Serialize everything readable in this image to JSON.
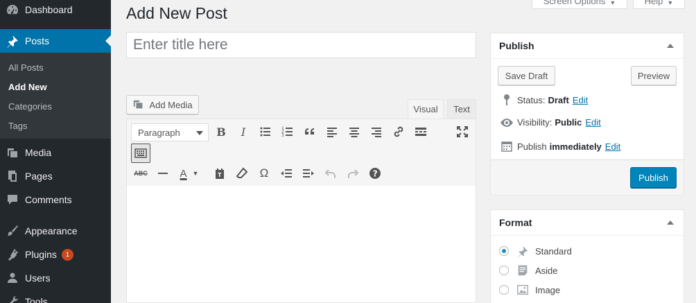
{
  "sidebar": {
    "items": [
      {
        "label": "Dashboard",
        "icon": "dashboard-icon"
      },
      {
        "label": "Posts",
        "icon": "pin-icon"
      },
      {
        "label": "Media",
        "icon": "media-icon"
      },
      {
        "label": "Pages",
        "icon": "pages-icon"
      },
      {
        "label": "Comments",
        "icon": "comment-icon"
      },
      {
        "label": "Appearance",
        "icon": "paintbrush-icon"
      },
      {
        "label": "Plugins",
        "icon": "plugin-icon",
        "badge": "1"
      },
      {
        "label": "Users",
        "icon": "user-icon"
      },
      {
        "label": "Tools",
        "icon": "wrench-icon"
      }
    ],
    "submenu": [
      "All Posts",
      "Add New",
      "Categories",
      "Tags"
    ]
  },
  "header": {
    "screen_options": "Screen Options",
    "help": "Help",
    "page_title": "Add New Post"
  },
  "editor": {
    "title_placeholder": "Enter title here",
    "add_media": "Add Media",
    "tab_visual": "Visual",
    "tab_text": "Text",
    "format_value": "Paragraph"
  },
  "publish_box": {
    "heading": "Publish",
    "save_draft": "Save Draft",
    "preview": "Preview",
    "status_label": "Status:",
    "status_value": "Draft",
    "visibility_label": "Visibility:",
    "visibility_value": "Public",
    "publish_label": "Publish",
    "publish_value": "immediately",
    "edit": "Edit",
    "publish_button": "Publish"
  },
  "format_box": {
    "heading": "Format",
    "options": [
      {
        "label": "Standard",
        "checked": true
      },
      {
        "label": "Aside",
        "checked": false
      },
      {
        "label": "Image",
        "checked": false
      }
    ]
  },
  "colors": {
    "sidebar_bg": "#23282d",
    "accent": "#0073aa",
    "publish_button": "#0085ba",
    "badge": "#ca4a1f"
  }
}
